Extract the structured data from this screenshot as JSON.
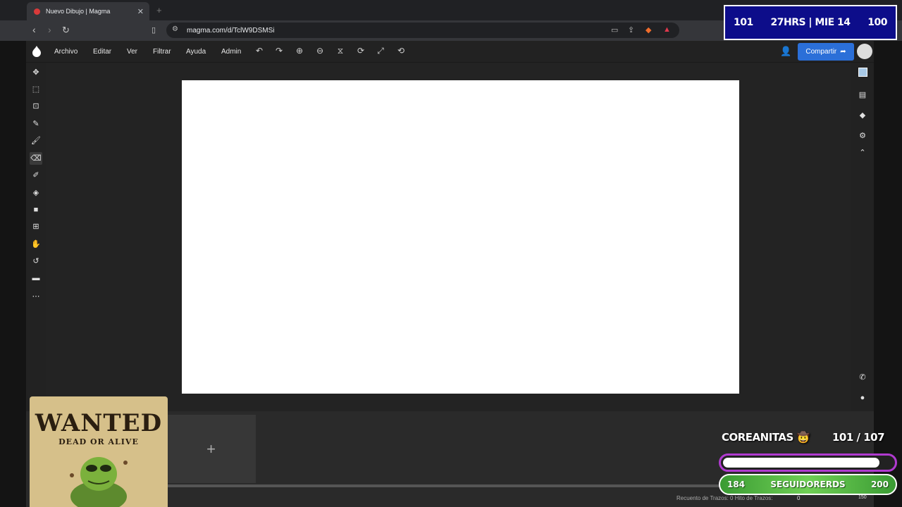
{
  "browser": {
    "tab_title": "Nuevo Dibujo | Magma",
    "tab_close": "✕",
    "new_tab": "+",
    "url": "magma.com/d/TclW9DSMSi"
  },
  "menu": {
    "items": [
      "Archivo",
      "Editar",
      "Ver",
      "Filtrar",
      "Ayuda",
      "Admin"
    ]
  },
  "share": {
    "label": "Compartir"
  },
  "status": {
    "label": "Recuento de Trazos: 0  Hito de Trazos:",
    "value": "0",
    "extra": "150"
  },
  "overlay": {
    "timer_left": "101",
    "timer_center": "27HRS | MIE 14",
    "timer_right": "100",
    "goal_label": "COREANITAS 🤠",
    "goal_count": "101  / 107",
    "goal_progress": 0.944,
    "followers_current": "184",
    "followers_label": "SEGUIDORERDS",
    "followers_target": "200"
  },
  "poster": {
    "title": "WANTED",
    "subtitle": "DEAD OR ALIVE"
  },
  "colors": {
    "accent": "#2b6fd8",
    "timer_bg": "#0d0d8a",
    "goal_border": "#b03ad0",
    "followers_green": "#4caf3a"
  }
}
